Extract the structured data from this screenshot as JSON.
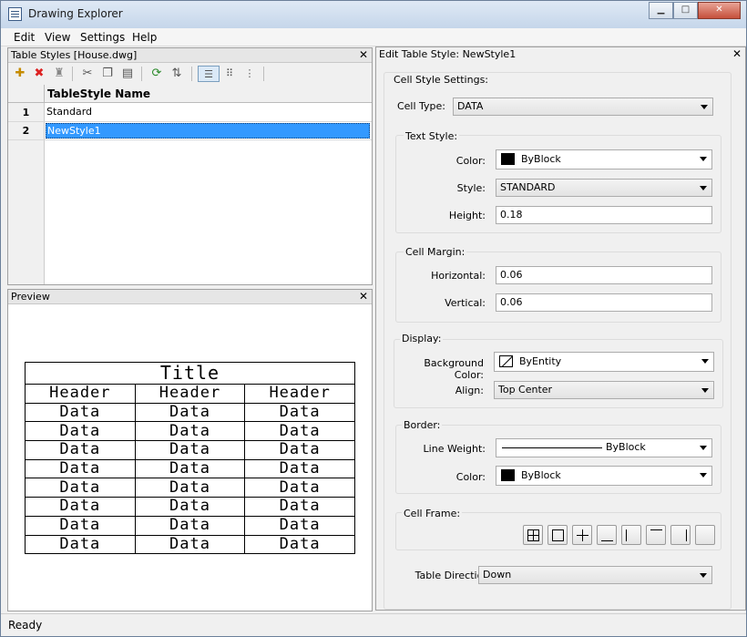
{
  "window": {
    "title": "Drawing Explorer",
    "min": "▁",
    "max": "□",
    "close": "✕"
  },
  "menu": [
    "Edit",
    "View",
    "Settings",
    "Help"
  ],
  "styles_panel": {
    "title": "Table Styles [House.dwg]",
    "column_header": "TableStyle Name",
    "rows": [
      {
        "num": "1",
        "name": "Standard",
        "selected": false
      },
      {
        "num": "2",
        "name": "NewStyle1",
        "selected": true
      }
    ],
    "toolbar_icons": [
      "new-icon",
      "delete-icon",
      "purge-icon",
      "cut-icon",
      "copy-icon",
      "paste-icon",
      "refresh-icon",
      "sync-icon",
      "details-view-icon",
      "grid-view-icon",
      "tree-view-icon"
    ]
  },
  "preview_panel": {
    "title": "Preview",
    "table_title": "Title",
    "headers": [
      "Header",
      "Header",
      "Header"
    ],
    "data_rows": [
      [
        "Data",
        "Data",
        "Data"
      ],
      [
        "Data",
        "Data",
        "Data"
      ],
      [
        "Data",
        "Data",
        "Data"
      ],
      [
        "Data",
        "Data",
        "Data"
      ],
      [
        "Data",
        "Data",
        "Data"
      ],
      [
        "Data",
        "Data",
        "Data"
      ],
      [
        "Data",
        "Data",
        "Data"
      ],
      [
        "Data",
        "Data",
        "Data"
      ]
    ]
  },
  "edit_panel": {
    "title": "Edit Table Style: NewStyle1",
    "cell_style_settings": "Cell Style Settings:",
    "cell_type_label": "Cell Type:",
    "cell_type_value": "DATA",
    "text_style": {
      "group": "Text Style:",
      "color_label": "Color:",
      "color_value": "ByBlock",
      "style_label": "Style:",
      "style_value": "STANDARD",
      "height_label": "Height:",
      "height_value": "0.18"
    },
    "cell_margin": {
      "group": "Cell Margin:",
      "horizontal_label": "Horizontal:",
      "horizontal_value": "0.06",
      "vertical_label": "Vertical:",
      "vertical_value": "0.06"
    },
    "display": {
      "group": "Display:",
      "bg_label": "Background Color:",
      "bg_value": "ByEntity",
      "align_label": "Align:",
      "align_value": "Top Center"
    },
    "border": {
      "group": "Border:",
      "lineweight_label": "Line Weight:",
      "lineweight_value": "ByBlock",
      "color_label": "Color:",
      "color_value": "ByBlock"
    },
    "cell_frame": {
      "group": "Cell Frame:",
      "buttons": [
        "all-borders-icon",
        "outside-border-icon",
        "inside-borders-icon",
        "bottom-border-icon",
        "left-border-icon",
        "top-border-icon",
        "right-border-icon",
        "no-border-icon"
      ]
    },
    "direction_label": "Table Direction:",
    "direction_value": "Down"
  },
  "status": "Ready"
}
